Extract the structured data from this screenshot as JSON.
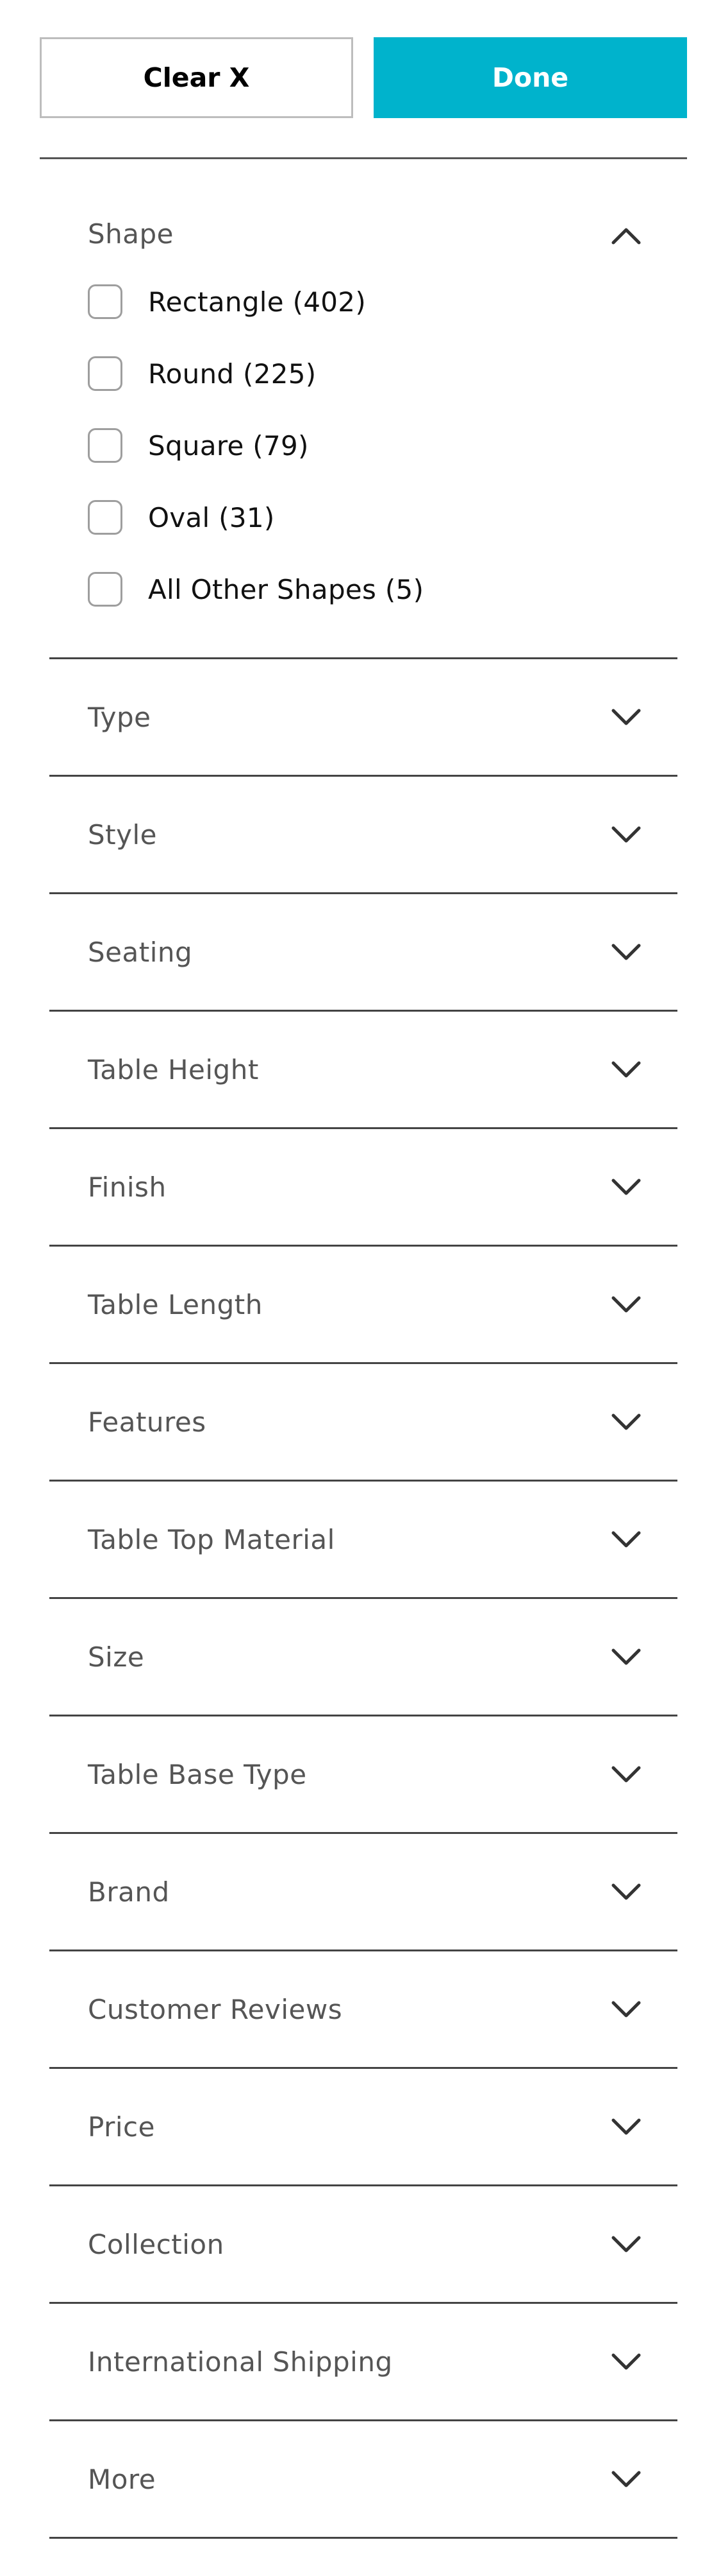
{
  "actions": {
    "clear_label": "Clear X",
    "done_label": "Done"
  },
  "colors": {
    "accent": "#00b3cc",
    "divider": "#444444",
    "checkbox_border": "#9e9e9e"
  },
  "shape": {
    "title": "Shape",
    "expanded": true,
    "options": [
      {
        "label": "Rectangle (402)",
        "checked": false
      },
      {
        "label": "Round (225)",
        "checked": false
      },
      {
        "label": "Square (79)",
        "checked": false
      },
      {
        "label": "Oval (31)",
        "checked": false
      },
      {
        "label": "All Other Shapes (5)",
        "checked": false
      }
    ]
  },
  "sections": [
    {
      "title": "Type",
      "expanded": false
    },
    {
      "title": "Style",
      "expanded": false
    },
    {
      "title": "Seating",
      "expanded": false
    },
    {
      "title": "Table Height",
      "expanded": false
    },
    {
      "title": "Finish",
      "expanded": false
    },
    {
      "title": "Table Length",
      "expanded": false
    },
    {
      "title": "Features",
      "expanded": false
    },
    {
      "title": "Table Top Material",
      "expanded": false
    },
    {
      "title": "Size",
      "expanded": false
    },
    {
      "title": "Table Base Type",
      "expanded": false
    },
    {
      "title": "Brand",
      "expanded": false
    },
    {
      "title": "Customer Reviews",
      "expanded": false
    },
    {
      "title": "Price",
      "expanded": false
    },
    {
      "title": "Collection",
      "expanded": false
    },
    {
      "title": "International Shipping",
      "expanded": false
    },
    {
      "title": "More",
      "expanded": false
    }
  ]
}
